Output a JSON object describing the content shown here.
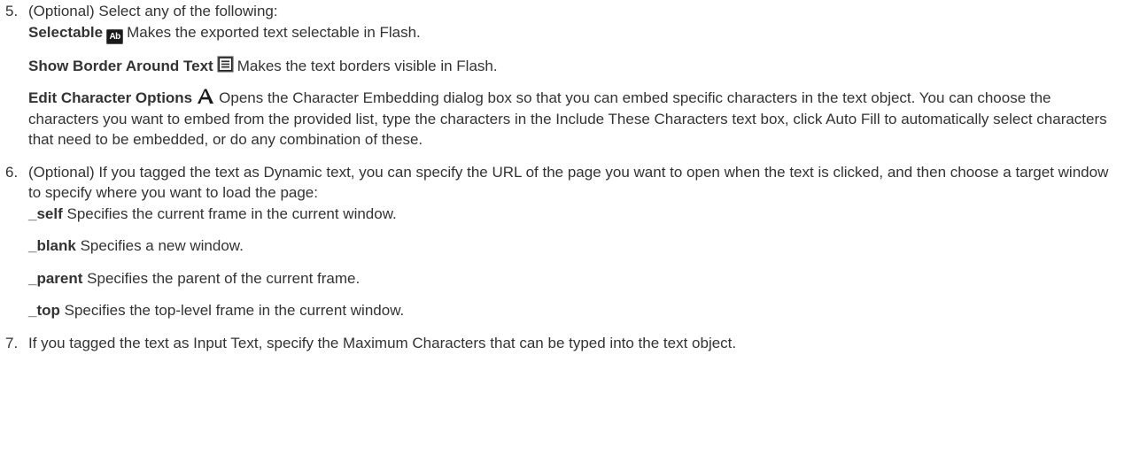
{
  "steps": [
    {
      "number": "5.",
      "intro": "(Optional) Select any of the following:",
      "options": [
        {
          "term": "Selectable",
          "icon": "selectable-ab-icon",
          "icon_text": "Ab",
          "desc": "Makes the exported text selectable in Flash."
        },
        {
          "term": "Show Border Around Text",
          "icon": "show-border-icon",
          "desc": "Makes the text borders visible in Flash."
        },
        {
          "term": "Edit Character Options",
          "icon": "character-options-icon",
          "desc": "Opens the Character Embedding dialog box so that you can embed specific characters in the text object. You can choose the characters you want to embed from the provided list, type the characters in the Include These Characters text box, click Auto Fill to automatically select characters that need to be embedded, or do any combination of these."
        }
      ]
    },
    {
      "number": "6.",
      "intro": "(Optional) If you tagged the text as Dynamic text, you can specify the URL of the page you want to open when the text is clicked, and then choose a target window to specify where you want to load the page:",
      "options": [
        {
          "term": "_self",
          "desc": "Specifies the current frame in the current window."
        },
        {
          "term": "_blank",
          "desc": "Specifies a new window."
        },
        {
          "term": "_parent",
          "desc": "Specifies the parent of the current frame."
        },
        {
          "term": "_top",
          "desc": "Specifies the top-level frame in the current window."
        }
      ]
    },
    {
      "number": "7.",
      "intro": "If you tagged the text as Input Text, specify the Maximum Characters that can be typed into the text object."
    }
  ]
}
